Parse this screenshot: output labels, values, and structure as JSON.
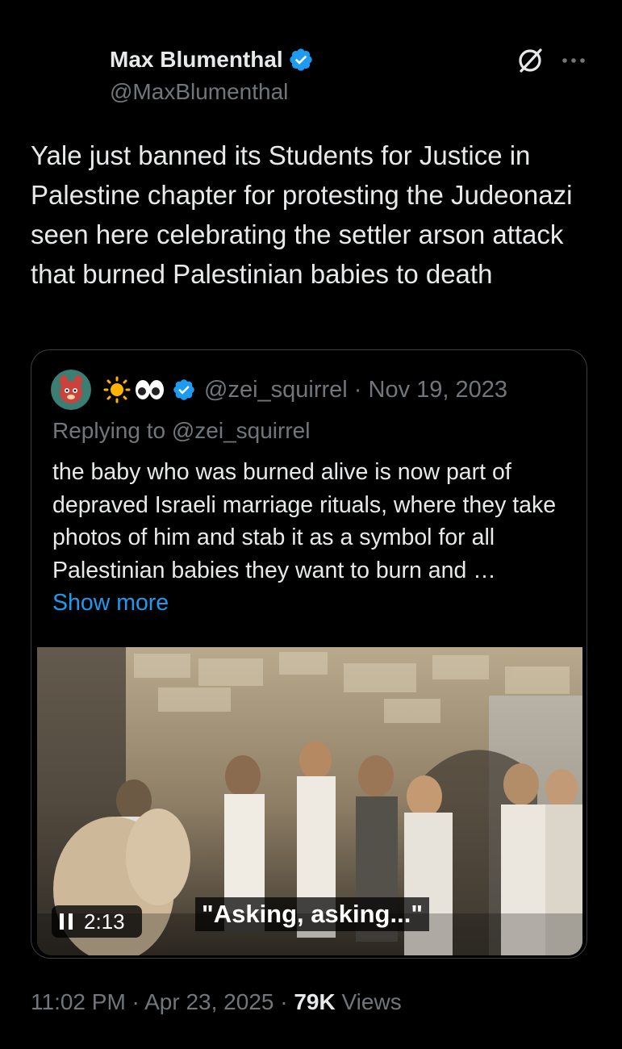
{
  "author": {
    "display_name": "Max Blumenthal",
    "handle": "@MaxBlumenthal",
    "verified": true
  },
  "icons": {
    "grok": "grok-icon",
    "more": "more-icon",
    "verified": "verified-badge-icon",
    "pause": "pause-icon"
  },
  "tweet": {
    "text": "Yale just banned its Students for Justice in Palestine chapter for protesting the Judeonazi seen here celebrating the settler arson attack that burned Palestinian babies to death"
  },
  "quoted": {
    "name_emoji": "☀️👀",
    "handle": "@zei_squirrel",
    "separator": " · ",
    "date": "Nov 19, 2023",
    "replying_to": "Replying to @zei_squirrel",
    "text": "the baby who was burned alive is now part of depraved Israeli marriage rituals, where they take photos of him and stab it as a symbol for all Palestinian babies they want to burn and …",
    "show_more": "Show more",
    "video": {
      "caption": "\"Asking, asking...\"",
      "duration": "2:13"
    }
  },
  "footer": {
    "time": "11:02 PM",
    "sep1": " · ",
    "date": "Apr 23, 2025",
    "sep2": " · ",
    "views_count": "79K",
    "views_label": " Views"
  },
  "colors": {
    "background": "#000000",
    "text": "#e7e9ea",
    "secondary": "#71767b",
    "link": "#1d9bf0",
    "verified": "#1d9bf0"
  }
}
